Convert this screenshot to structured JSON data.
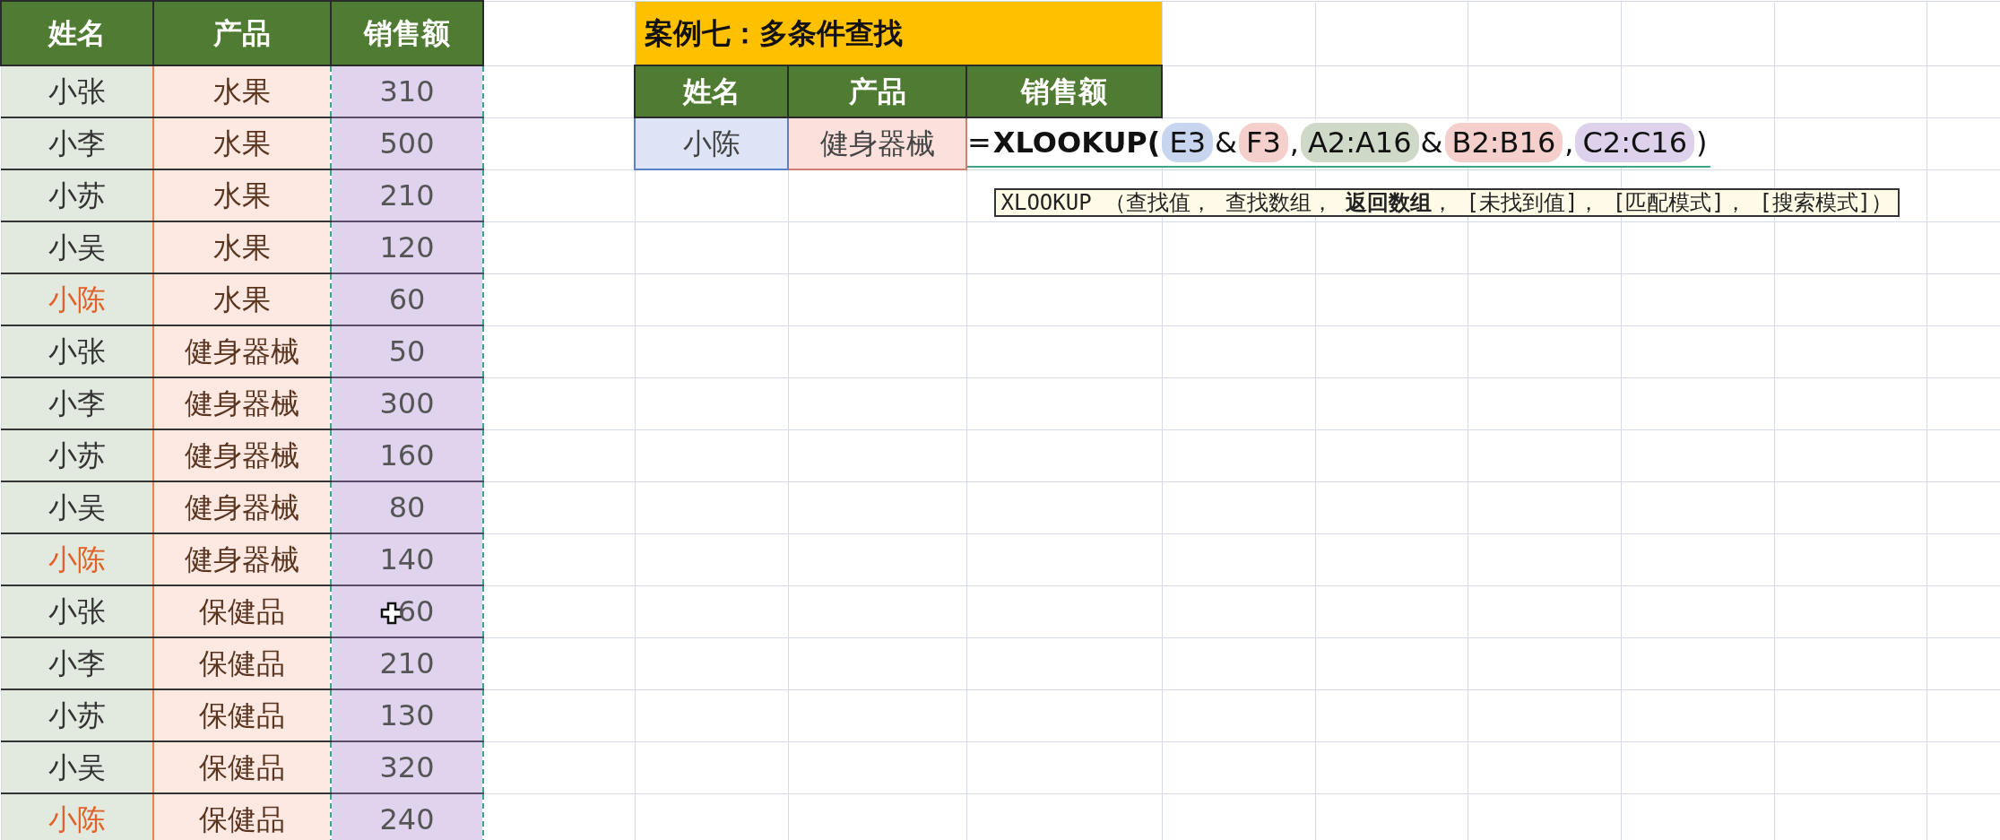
{
  "left_table": {
    "columns": [
      "姓名",
      "产品",
      "销售额"
    ],
    "rows": [
      {
        "name": "小张",
        "product": "水果",
        "sales": "310",
        "highlighted": false
      },
      {
        "name": "小李",
        "product": "水果",
        "sales": "500",
        "highlighted": false
      },
      {
        "name": "小苏",
        "product": "水果",
        "sales": "210",
        "highlighted": false
      },
      {
        "name": "小吴",
        "product": "水果",
        "sales": "120",
        "highlighted": false
      },
      {
        "name": "小陈",
        "product": "水果",
        "sales": "60",
        "highlighted": true
      },
      {
        "name": "小张",
        "product": "健身器械",
        "sales": "50",
        "highlighted": false
      },
      {
        "name": "小李",
        "product": "健身器械",
        "sales": "300",
        "highlighted": false
      },
      {
        "name": "小苏",
        "product": "健身器械",
        "sales": "160",
        "highlighted": false
      },
      {
        "name": "小吴",
        "product": "健身器械",
        "sales": "80",
        "highlighted": false
      },
      {
        "name": "小陈",
        "product": "健身器械",
        "sales": "140",
        "highlighted": true
      },
      {
        "name": "小张",
        "product": "保健品",
        "sales": "60",
        "highlighted": false,
        "cursor": true
      },
      {
        "name": "小李",
        "product": "保健品",
        "sales": "210",
        "highlighted": false
      },
      {
        "name": "小苏",
        "product": "保健品",
        "sales": "130",
        "highlighted": false
      },
      {
        "name": "小吴",
        "product": "保健品",
        "sales": "320",
        "highlighted": false
      },
      {
        "name": "小陈",
        "product": "保健品",
        "sales": "240",
        "highlighted": true
      }
    ]
  },
  "lookup": {
    "title": "案例七：多条件查找",
    "columns": [
      "姓名",
      "产品",
      "销售额"
    ],
    "name": "小陈",
    "product": "健身器械",
    "formula": {
      "prefix": "=",
      "function": "XLOOKUP(",
      "parts": [
        {
          "kind": "ref",
          "text": "E3",
          "color": "#c8d5ef"
        },
        {
          "kind": "op",
          "text": "&"
        },
        {
          "kind": "ref",
          "text": "F3",
          "color": "#f4cfcc"
        },
        {
          "kind": "op",
          "text": ","
        },
        {
          "kind": "ref",
          "text": "A2:A16",
          "color": "#cfd9c8"
        },
        {
          "kind": "op",
          "text": "&"
        },
        {
          "kind": "ref",
          "text": "B2:B16",
          "color": "#f4cfcc"
        },
        {
          "kind": "op",
          "text": ","
        },
        {
          "kind": "ref",
          "text": "C2:C16",
          "color": "#ddd1ec"
        }
      ],
      "suffix": ")"
    }
  },
  "tooltip": "XLOOKUP （查找值， 查找数组， **返回数组**， [未找到值]， [匹配模式]， [搜索模式]）"
}
